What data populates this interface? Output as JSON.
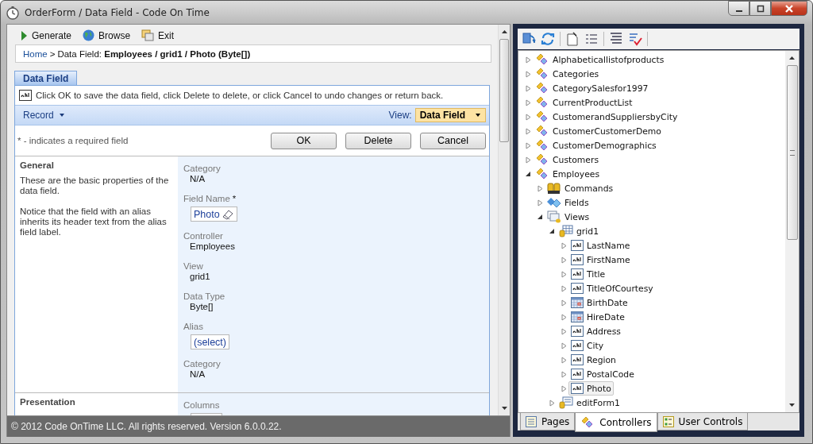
{
  "window": {
    "title": "OrderForm / Data Field - Code On Time"
  },
  "toolbar": [
    {
      "label": "Generate",
      "kind": "generate"
    },
    {
      "label": "Browse",
      "kind": "browse"
    },
    {
      "label": "Exit",
      "kind": "exit"
    }
  ],
  "breadcrumb": {
    "home": "Home",
    "separator": ">",
    "current": "Data Field: **Employees / grid1 / Photo (Byte[])**"
  },
  "form": {
    "tab": {
      "label": "Data Field",
      "selected": true
    },
    "hint": "Click OK to save the data field, click Delete to delete, or click Cancel to undo changes or return back.",
    "record_menu": "Record",
    "view_label": "View:",
    "view_value": "Data Field",
    "required_note": "* - indicates a required field",
    "buttons": [
      "OK",
      "Delete",
      "Cancel"
    ],
    "sections": [
      {
        "title": "General",
        "description": [
          "These are the basic properties of the data field.",
          "Notice that the field with an alias inherits its header text from the alias field label."
        ],
        "fields": [
          {
            "label": "Category",
            "value": "N/A",
            "kind": "text"
          },
          {
            "label": "Field Name",
            "required_mark": "*",
            "value": "Photo",
            "kind": "lookup"
          },
          {
            "label": "Controller",
            "value": "Employees",
            "kind": "text"
          },
          {
            "label": "View",
            "value": "grid1",
            "kind": "text"
          },
          {
            "label": "Data Type",
            "value": "Byte[]",
            "kind": "text"
          },
          {
            "label": "Alias",
            "value": "(select)",
            "kind": "lookup"
          },
          {
            "label": "Category",
            "value": "N/A",
            "kind": "text"
          }
        ]
      },
      {
        "title": "Presentation",
        "fields": [
          {
            "label": "Columns",
            "kind": "input"
          }
        ]
      }
    ]
  },
  "footer": "© 2012 Code OnTime LLC. All rights reserved. Version 6.0.0.22.",
  "explorer": {
    "tree": [
      {
        "label": "Alphabeticallistofproducts",
        "kind": "controller",
        "expanded": false,
        "selected": false
      },
      {
        "label": "Categories",
        "kind": "controller",
        "expanded": false,
        "selected": false
      },
      {
        "label": "CategorySalesfor1997",
        "kind": "controller",
        "expanded": false,
        "selected": false
      },
      {
        "label": "CurrentProductList",
        "kind": "controller",
        "expanded": false,
        "selected": false
      },
      {
        "label": "CustomerandSuppliersbyCity",
        "kind": "controller",
        "expanded": false,
        "selected": false
      },
      {
        "label": "CustomerCustomerDemo",
        "kind": "controller",
        "expanded": false,
        "selected": false
      },
      {
        "label": "CustomerDemographics",
        "kind": "controller",
        "expanded": false,
        "selected": false
      },
      {
        "label": "Customers",
        "kind": "controller",
        "expanded": false,
        "selected": false
      },
      {
        "label": "Employees",
        "kind": "controller",
        "expanded": true,
        "selected": false,
        "children": [
          {
            "label": "Commands",
            "kind": "commands",
            "expanded": false,
            "selected": false
          },
          {
            "label": "Fields",
            "kind": "fields",
            "expanded": false,
            "selected": false
          },
          {
            "label": "Views",
            "kind": "views",
            "expanded": true,
            "selected": false,
            "children": [
              {
                "label": "grid1",
                "kind": "grid-view",
                "expanded": true,
                "selected": false,
                "children": [
                  {
                    "label": "LastName",
                    "kind": "text-field",
                    "expanded": false,
                    "selected": false
                  },
                  {
                    "label": "FirstName",
                    "kind": "text-field",
                    "expanded": false,
                    "selected": false
                  },
                  {
                    "label": "Title",
                    "kind": "text-field",
                    "expanded": false,
                    "selected": false
                  },
                  {
                    "label": "TitleOfCourtesy",
                    "kind": "text-field",
                    "expanded": false,
                    "selected": false
                  },
                  {
                    "label": "BirthDate",
                    "kind": "date-field",
                    "expanded": false,
                    "selected": false
                  },
                  {
                    "label": "HireDate",
                    "kind": "date-field",
                    "expanded": false,
                    "selected": false
                  },
                  {
                    "label": "Address",
                    "kind": "text-field",
                    "expanded": false,
                    "selected": false
                  },
                  {
                    "label": "City",
                    "kind": "text-field",
                    "expanded": false,
                    "selected": false
                  },
                  {
                    "label": "Region",
                    "kind": "text-field",
                    "expanded": false,
                    "selected": false
                  },
                  {
                    "label": "PostalCode",
                    "kind": "text-field",
                    "expanded": false,
                    "selected": false
                  },
                  {
                    "label": "Photo",
                    "kind": "text-field",
                    "expanded": false,
                    "selected": true
                  }
                ]
              },
              {
                "label": "editForm1",
                "kind": "form-view",
                "expanded": false,
                "selected": false
              }
            ]
          }
        ]
      }
    ],
    "tabs": [
      {
        "label": "Pages",
        "kind": "pages",
        "selected": false
      },
      {
        "label": "Controllers",
        "kind": "controllers",
        "selected": true
      },
      {
        "label": "User Controls",
        "kind": "user-controls",
        "selected": false
      }
    ]
  }
}
